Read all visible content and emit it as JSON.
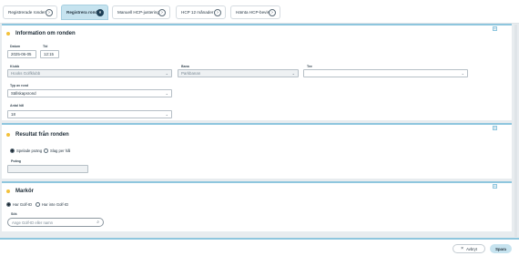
{
  "tabs": [
    {
      "label": "Registrerade ronder",
      "icon": "chevron-circle-icon"
    },
    {
      "label": "Registrera rond",
      "icon": "close-circle-icon",
      "active": true
    },
    {
      "label": "Manuell HCP-justering",
      "icon": "chevron-circle-icon"
    },
    {
      "label": "HCP 12 månader",
      "icon": "chevron-circle-icon"
    },
    {
      "label": "Hämta HCP-bevis",
      "icon": "chevron-circle-icon"
    }
  ],
  "round_info": {
    "title": "Information om ronden",
    "date_label": "Datum",
    "date_value": "2025-06-05",
    "time_label": "Tid",
    "time_value": "12:15",
    "club_label": "Klubb",
    "club_value": "Hooks Golfklubb",
    "course_label": "Bana",
    "course_value": "Parkbanan",
    "tee_label": "Tee",
    "tee_value": "",
    "round_type_label": "Typ av rond",
    "round_type_value": "Sällskapsrond",
    "holes_label": "Antal hål",
    "holes_value": "18"
  },
  "result": {
    "title": "Resultat från ronden",
    "option_points": "Spelade poäng",
    "option_strokes": "Slag per hål",
    "points_label": "Poäng",
    "points_value": ""
  },
  "marker": {
    "title": "Markör",
    "option_has_id": "Har Golf-ID",
    "option_no_id": "Har inte Golf-ID",
    "search_label": "Sök",
    "search_placeholder": "Ange Golf-ID eller namn"
  },
  "footer": {
    "cancel_label": "Avbryt",
    "save_label": "Spara"
  },
  "colors": {
    "accent": "#8ec6de",
    "active_tab": "#c6e3ef",
    "section_dot": "#f3c13a"
  }
}
